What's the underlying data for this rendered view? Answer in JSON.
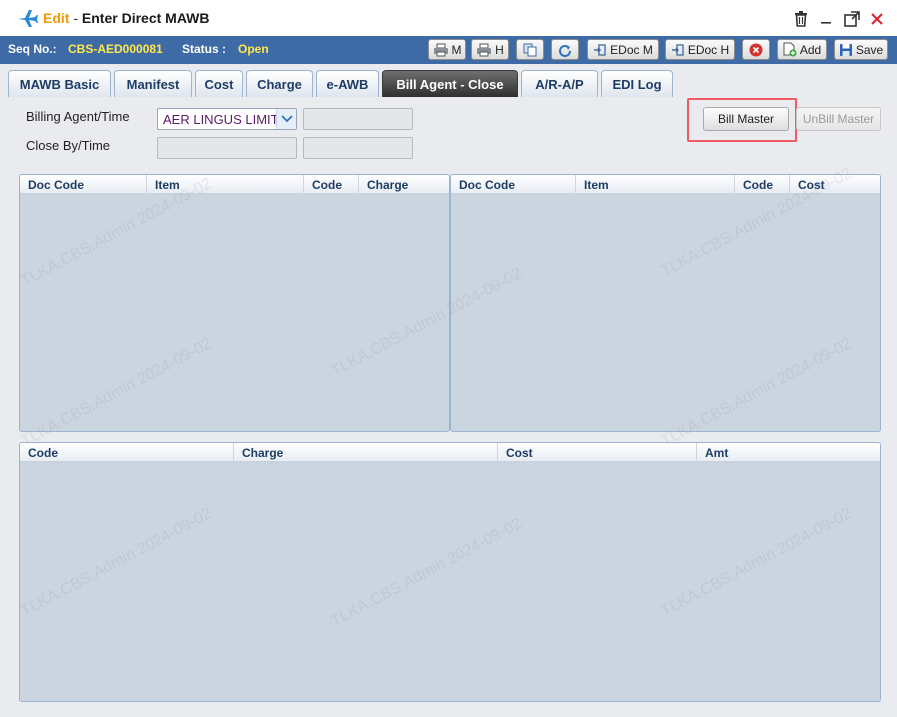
{
  "window": {
    "edit_label": "Edit",
    "separator": "-",
    "title": "Enter Direct MAWB"
  },
  "status_bar": {
    "seq_label": "Seq No.:",
    "seq_value": "CBS-AED000081",
    "status_label": "Status :",
    "status_value": "Open",
    "print_m_label": "M",
    "print_h_label": "H",
    "edoc_m_label": "EDoc M",
    "edoc_h_label": "EDoc H",
    "add_label": "Add",
    "save_label": "Save"
  },
  "tabs": [
    {
      "label": "MAWB Basic",
      "active": false
    },
    {
      "label": "Manifest",
      "active": false
    },
    {
      "label": "Cost",
      "active": false
    },
    {
      "label": "Charge",
      "active": false
    },
    {
      "label": "e-AWB",
      "active": false
    },
    {
      "label": "Bill Agent - Close",
      "active": true
    },
    {
      "label": "A/R-A/P",
      "active": false
    },
    {
      "label": "EDI Log",
      "active": false
    }
  ],
  "form": {
    "billing_agent_label": "Billing Agent/Time",
    "billing_agent_value": "AER LINGUS LIMITED",
    "close_by_label": "Close By/Time",
    "bill_master_label": "Bill Master",
    "unbill_master_label": "UnBill Master"
  },
  "grid_left": {
    "columns": [
      "Doc Code",
      "Item",
      "Code",
      "Charge"
    ]
  },
  "grid_right": {
    "columns": [
      "Doc Code",
      "Item",
      "Code",
      "Cost"
    ]
  },
  "grid_bottom": {
    "columns": [
      "Code",
      "Charge",
      "Cost",
      "Amt"
    ]
  },
  "watermark": "TLKA.CBS.Admin 2024-09-02",
  "colors": {
    "status_bar": "#3e6aa6",
    "accent_yellow": "#ffe84a",
    "edit_orange": "#f19a00",
    "highlight_red": "#ef5a64",
    "grid_body": "#cbd5e0"
  }
}
